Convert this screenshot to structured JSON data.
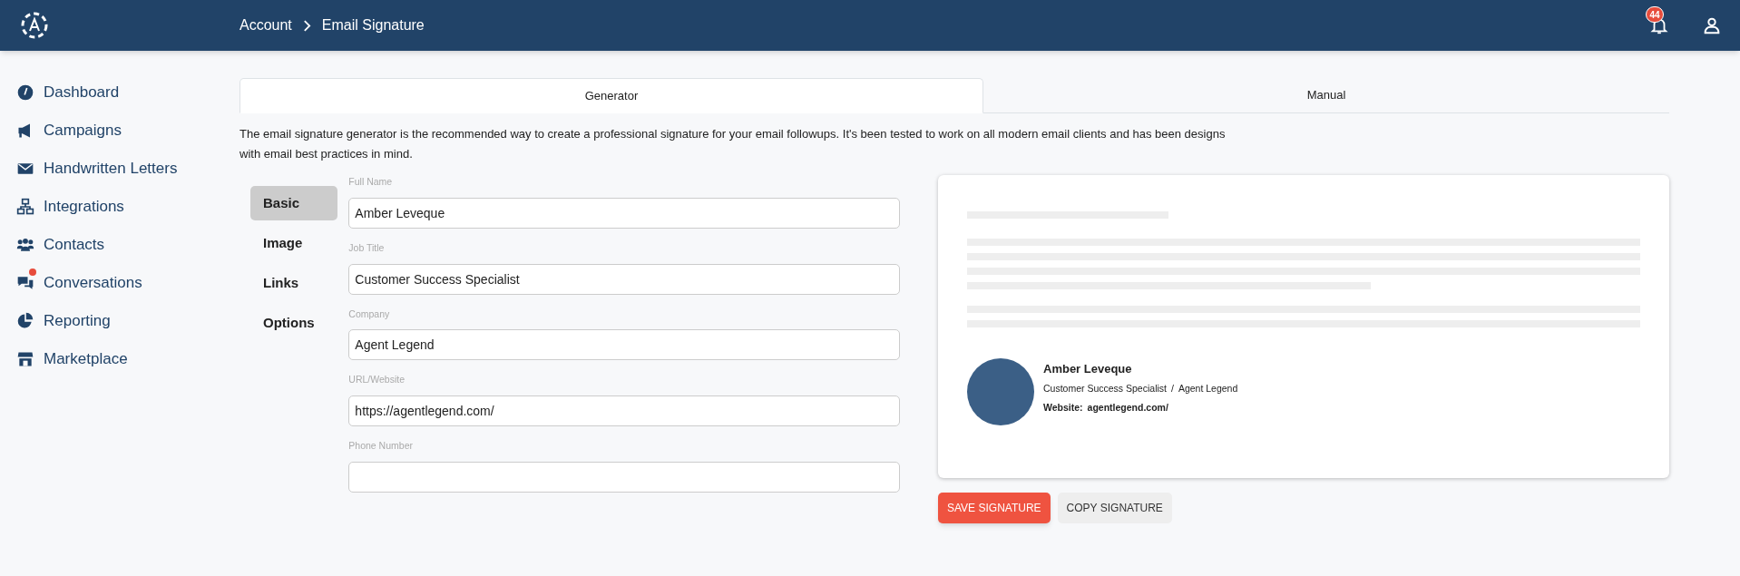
{
  "header": {
    "breadcrumb": [
      "Account",
      "Email Signature"
    ],
    "notification_count": "44"
  },
  "sidebar": {
    "items": [
      {
        "label": "Dashboard",
        "notification": false
      },
      {
        "label": "Campaigns",
        "notification": false
      },
      {
        "label": "Handwritten Letters",
        "notification": false
      },
      {
        "label": "Integrations",
        "notification": false
      },
      {
        "label": "Contacts",
        "notification": false
      },
      {
        "label": "Conversations",
        "notification": true
      },
      {
        "label": "Reporting",
        "notification": false
      },
      {
        "label": "Marketplace",
        "notification": false
      }
    ]
  },
  "tabs": [
    {
      "label": "Generator",
      "selected": true
    },
    {
      "label": "Manual",
      "selected": false
    }
  ],
  "description": "The email signature generator is the recommended way to create a professional signature for your email followups. It's been tested to work on all modern email clients and has been designs with email best practices in mind.",
  "sections": [
    {
      "label": "Basic",
      "selected": true
    },
    {
      "label": "Image",
      "selected": false
    },
    {
      "label": "Links",
      "selected": false
    },
    {
      "label": "Options",
      "selected": false
    }
  ],
  "fields": [
    {
      "label": "Full Name",
      "value": "Amber Leveque"
    },
    {
      "label": "Job Title",
      "value": "Customer Success Specialist"
    },
    {
      "label": "Company",
      "value": "Agent Legend"
    },
    {
      "label": "URL/Website",
      "value": "https://agentlegend.com/"
    },
    {
      "label": "Phone Number"
    }
  ],
  "preview": {
    "name": "Amber Leveque",
    "job_title": "Customer Success Specialist",
    "separator": "/",
    "company": "Agent Legend",
    "website_label": "Website:",
    "website": "agentlegend.com/"
  },
  "buttons": [
    {
      "label": "SAVE SIGNATURE",
      "kind": "primary"
    },
    {
      "label": "COPY SIGNATURE",
      "kind": "secondary"
    }
  ]
}
